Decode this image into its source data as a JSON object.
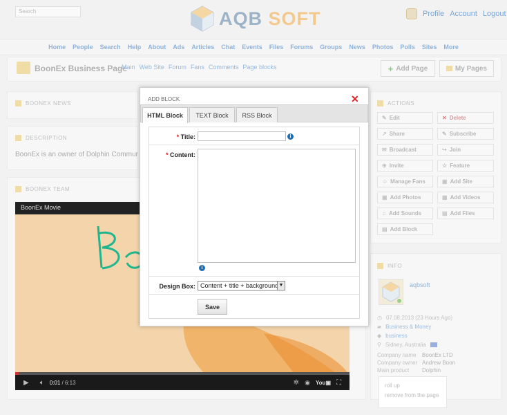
{
  "header": {
    "search_placeholder": "Search",
    "logo_part1": "AQB",
    "logo_part2": "SOFT",
    "profile": "Profile",
    "account": "Account",
    "logout": "Logout"
  },
  "nav": [
    "Home",
    "People",
    "Search",
    "Help",
    "About",
    "Ads",
    "Articles",
    "Chat",
    "Events",
    "Files",
    "Forums",
    "Groups",
    "News",
    "Photos",
    "Polls",
    "Sites",
    "More"
  ],
  "page": {
    "title": "BoonEx Business Page",
    "tabs": [
      "Main",
      "Web Site",
      "Forum",
      "Fans",
      "Comments",
      "Page blocks"
    ],
    "add_page": "Add Page",
    "my_pages": "My Pages"
  },
  "left": {
    "news_title": "BOONEX NEWS",
    "desc_title": "DESCRIPTION",
    "desc_text": "BoonEx is an owner of Dolphin Community Builder",
    "team_title": "BOONEX TEAM",
    "video_title": "BoonEx Movie",
    "video_time": "0:01",
    "video_duration": "/ 6:13",
    "video_progress": 0.01
  },
  "actions": {
    "title": "ACTIONS",
    "items": [
      {
        "label": "Edit",
        "icon": "✎"
      },
      {
        "label": "Delete",
        "icon": "✕"
      },
      {
        "label": "Share",
        "icon": "↗"
      },
      {
        "label": "Subscribe",
        "icon": "✎"
      },
      {
        "label": "Broadcast",
        "icon": "✉"
      },
      {
        "label": "Join",
        "icon": "↪"
      },
      {
        "label": "Invite",
        "icon": "⊕"
      },
      {
        "label": "Feature",
        "icon": "☆"
      },
      {
        "label": "Manage Fans",
        "icon": "☺"
      },
      {
        "label": "Add Site",
        "icon": "▣"
      },
      {
        "label": "Add Photos",
        "icon": "▣"
      },
      {
        "label": "Add Videos",
        "icon": "▦"
      },
      {
        "label": "Add Sounds",
        "icon": "♫"
      },
      {
        "label": "Add Files",
        "icon": "▤"
      },
      {
        "label": "Add Block",
        "icon": "▤"
      }
    ]
  },
  "info": {
    "title": "INFO",
    "name": "aqbsoft",
    "date": "07.08.2013 (23 Hours Ago)",
    "category": "Business & Money",
    "tag": "business",
    "location": "Sidney, Australia",
    "company_name_label": "Company name",
    "company_name": "BoonEx LTD",
    "company_owner_label": "Company owner",
    "company_owner": "Andrew Boon",
    "main_product_label": "Main product",
    "main_product": "Dolphin"
  },
  "popup_menu": [
    "roll up",
    "remove from the page"
  ],
  "dialog": {
    "title": "ADD BLOCK",
    "tabs": [
      "HTML Block",
      "TEXT Block",
      "RSS Block"
    ],
    "title_label": "Title:",
    "content_label": "Content:",
    "design_box_label": "Design Box:",
    "design_box_value": "Content + title + background",
    "save": "Save",
    "required_mark": "*"
  },
  "colors": {
    "accent_link": "#5a8fc9",
    "close_red": "#dd2222",
    "info_blue": "#1e6fb8"
  }
}
